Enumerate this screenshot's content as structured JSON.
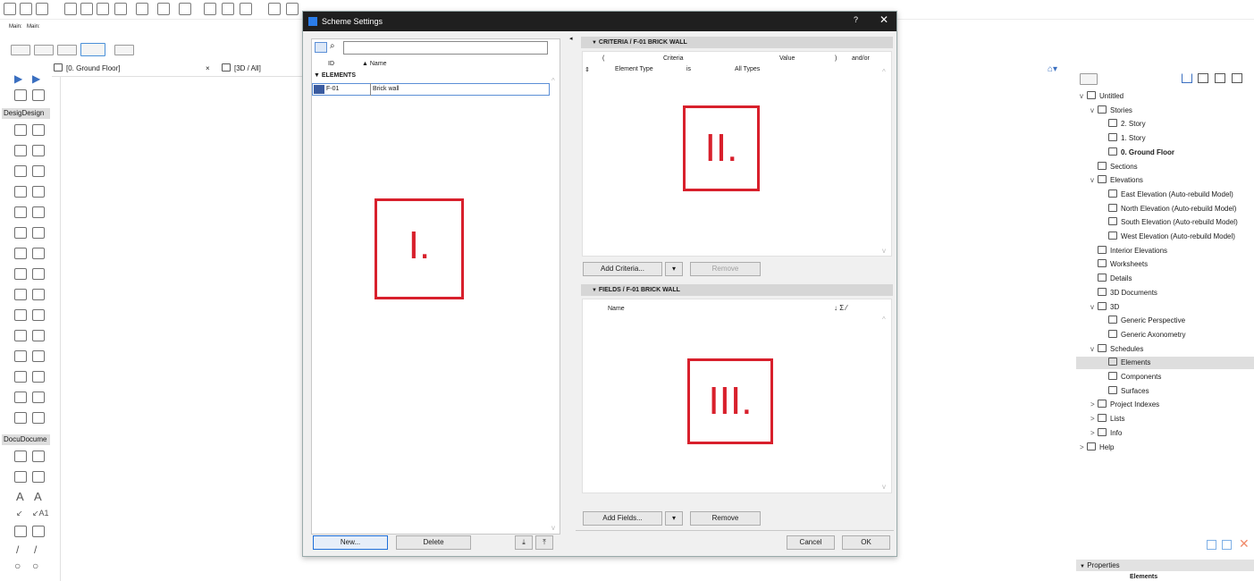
{
  "toolbar": {
    "main_label": "Main:",
    "main_label2": "Main:"
  },
  "tabs": [
    {
      "label": "[0. Ground Floor]",
      "close": "×"
    },
    {
      "label": "[3D / All]"
    }
  ],
  "palette": {
    "design_header": "Desig",
    "design_header2": "Design",
    "docu_header": "Docu",
    "docu_header2": "Docume",
    "text_tool": "A1"
  },
  "dialog": {
    "title": "Scheme Settings",
    "help": "?",
    "close": "✕",
    "list": {
      "col_id": "ID",
      "col_name": "Name",
      "group": "ELEMENTS",
      "rows": [
        {
          "id": "F-01",
          "name": "Brick wall"
        }
      ]
    },
    "criteria": {
      "header": "CRITERIA / F-01 BRICK WALL",
      "cols": [
        "(",
        "Criteria",
        "Value",
        ")",
        "and/or"
      ],
      "row": {
        "criteria": "Element Type",
        "op": "is",
        "value": "All Types"
      },
      "add_button": "Add Criteria...",
      "remove_button": "Remove"
    },
    "fields": {
      "header": "FIELDS / F-01 BRICK WALL",
      "col_name": "Name",
      "col_icons": "↓ Σ ⁄",
      "add_button": "Add Fields...",
      "remove_button": "Remove"
    },
    "new_button": "New...",
    "delete_button": "Delete",
    "cancel_button": "Cancel",
    "ok_button": "OK",
    "marker1": "I.",
    "marker2": "II.",
    "marker3": "III."
  },
  "navigator": {
    "items": [
      {
        "label": "Untitled",
        "level": 0,
        "chev": "v"
      },
      {
        "label": "Stories",
        "level": 1,
        "chev": "v"
      },
      {
        "label": "2. Story",
        "level": 2
      },
      {
        "label": "1. Story",
        "level": 2
      },
      {
        "label": "0. Ground Floor",
        "level": 2,
        "bold": true
      },
      {
        "label": "Sections",
        "level": 1
      },
      {
        "label": "Elevations",
        "level": 1,
        "chev": "v"
      },
      {
        "label": "East Elevation (Auto-rebuild Model)",
        "level": 2
      },
      {
        "label": "North Elevation (Auto-rebuild Model)",
        "level": 2
      },
      {
        "label": "South Elevation (Auto-rebuild Model)",
        "level": 2
      },
      {
        "label": "West Elevation (Auto-rebuild Model)",
        "level": 2
      },
      {
        "label": "Interior Elevations",
        "level": 1
      },
      {
        "label": "Worksheets",
        "level": 1
      },
      {
        "label": "Details",
        "level": 1
      },
      {
        "label": "3D Documents",
        "level": 1
      },
      {
        "label": "3D",
        "level": 1,
        "chev": "v"
      },
      {
        "label": "Generic Perspective",
        "level": 2
      },
      {
        "label": "Generic Axonometry",
        "level": 2
      },
      {
        "label": "Schedules",
        "level": 1,
        "chev": "v"
      },
      {
        "label": "Elements",
        "level": 2,
        "selected": true
      },
      {
        "label": "Components",
        "level": 2
      },
      {
        "label": "Surfaces",
        "level": 2
      },
      {
        "label": "Project Indexes",
        "level": 1,
        "chev": ">"
      },
      {
        "label": "Lists",
        "level": 1,
        "chev": ">"
      },
      {
        "label": "Info",
        "level": 1,
        "chev": ">"
      },
      {
        "label": "Help",
        "level": 0,
        "chev": ">"
      }
    ],
    "properties_label": "Properties",
    "properties_value": "Elements"
  },
  "colors": {
    "accent_red": "#d8202c",
    "primary_blue": "#1e6fd9",
    "titlebar": "#1f1f1f"
  }
}
